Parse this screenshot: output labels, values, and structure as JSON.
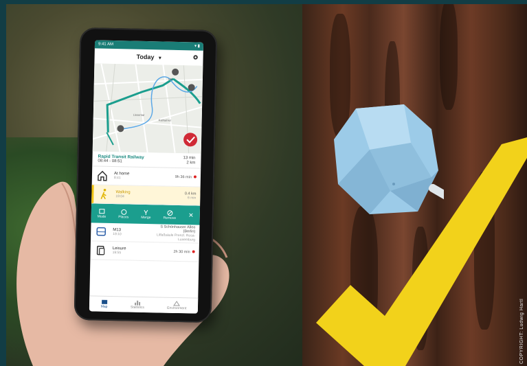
{
  "phone": {
    "status_time": "9:41 AM",
    "status_icons": "▾ ▮",
    "title": "Today",
    "title_chevron": "▾",
    "map_labels": [
      "Hbf",
      "Liesental",
      "Katharinel"
    ],
    "route_card": {
      "title": "Rapid Transit Railway",
      "times": "08:44 - 08:51",
      "duration": "13 min",
      "distance": "2 km"
    },
    "timeline": [
      {
        "icon": "home-icon",
        "title": "At home",
        "sub": "8:41",
        "right": "9h 36 min",
        "dot": true,
        "active": false
      },
      {
        "icon": "walk-icon",
        "title": "Walking",
        "sub": "19:04",
        "right": "0.4 km",
        "right_sub": "6 min",
        "dot": false,
        "active": true
      },
      {
        "icon": "bus-icon",
        "title": "M13",
        "sub": "19:10",
        "right": "S Schönhauser Allee (Berlin)",
        "right_sub": "Litfaßsäule Prenzl. Rosa-Luxemburg",
        "dot": false,
        "active": false
      },
      {
        "icon": "leisure-icon",
        "title": "Leisure",
        "sub": "19:55",
        "right": "2h 30 min",
        "dot": true,
        "active": false
      }
    ],
    "actions": [
      "Mode",
      "Places",
      "Merge",
      "Remove"
    ],
    "nav": [
      "Map",
      "Statistics",
      "Environment"
    ]
  },
  "credit": "COPYRIGHT: Ludwig Hartl"
}
